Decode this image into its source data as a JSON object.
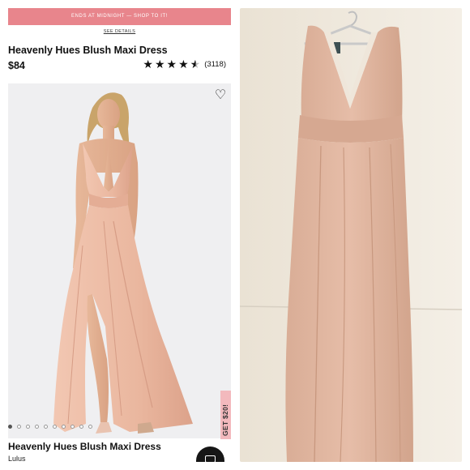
{
  "promo": {
    "text": "ENDS AT MIDNIGHT — SHOP TO IT!",
    "link": "SEE DETAILS"
  },
  "product": {
    "title": "Heavenly Hues Blush Maxi Dress",
    "price": "$84",
    "rating": 4.5,
    "review_count": "(3118)"
  },
  "gallery": {
    "image_count": 10,
    "active_index": 0
  },
  "side_tab": {
    "label": "GET $20!"
  },
  "recommendation": {
    "title": "Heavenly Hues Blush Maxi Dress",
    "brand": "Lulus"
  },
  "icons": {
    "wishlist": "heart-icon",
    "chat": "chat-icon",
    "star": "star-icon"
  },
  "colors": {
    "promo_bar": "#e8858c",
    "dress_blush": "#e9bba4",
    "side_tab": "#f3b9bd"
  }
}
